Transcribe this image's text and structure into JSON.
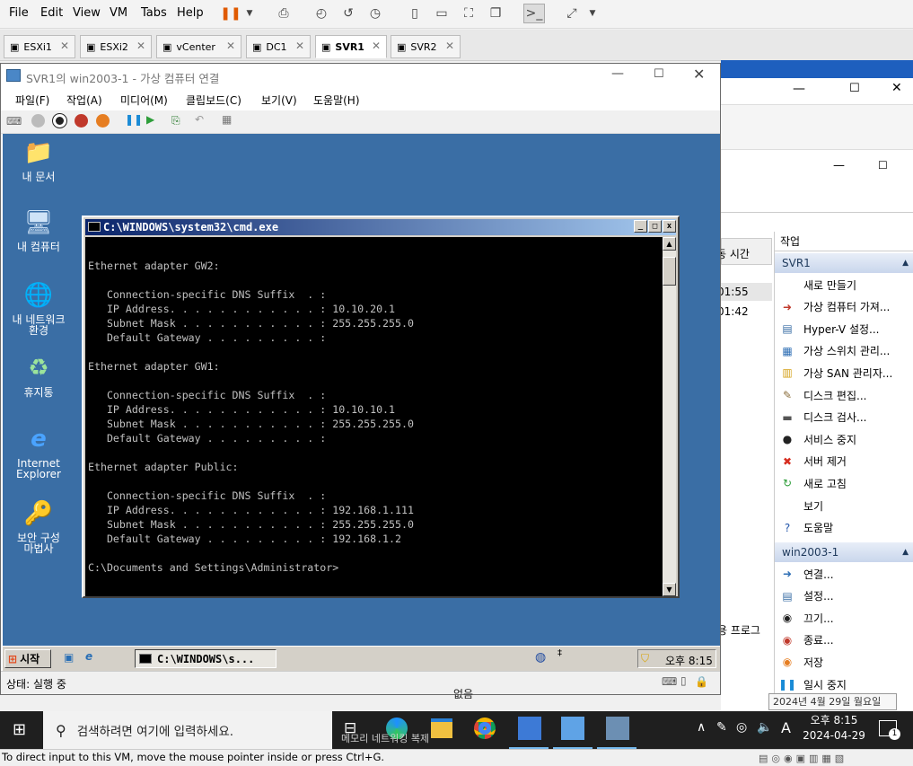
{
  "workstation": {
    "menu": [
      "File",
      "Edit",
      "View",
      "VM",
      "Tabs",
      "Help"
    ],
    "tabs": [
      {
        "label": "ESXi1",
        "active": false
      },
      {
        "label": "ESXi2",
        "active": false
      },
      {
        "label": "vCenter",
        "active": false
      },
      {
        "label": "DC1",
        "active": false
      },
      {
        "label": "SVR1",
        "active": true
      },
      {
        "label": "SVR2",
        "active": false
      }
    ],
    "status_text": "To direct input to this VM, move the mouse pointer inside or press Ctrl+G."
  },
  "vm_connection": {
    "title": "SVR1의 win2003-1 - 가상 컴퓨터 연결",
    "menu": [
      "파일(F)",
      "작업(A)",
      "미디어(M)",
      "클립보드(C)",
      "보기(V)",
      "도움말(H)"
    ],
    "status": "상태: 실행 중"
  },
  "desktop_icons": [
    {
      "label_1": "내 문서",
      "label_2": "",
      "icon": "folder-icon"
    },
    {
      "label_1": "내 컴퓨터",
      "label_2": "",
      "icon": "computer-icon"
    },
    {
      "label_1": "내 네트워크",
      "label_2": "환경",
      "icon": "network-icon"
    },
    {
      "label_1": "휴지통",
      "label_2": "",
      "icon": "recycle-bin-icon"
    },
    {
      "label_1": "Internet",
      "label_2": "Explorer",
      "icon": "ie-icon"
    },
    {
      "label_1": "보안 구성",
      "label_2": "마법사",
      "icon": "security-wizard-icon"
    }
  ],
  "cmd": {
    "title": "C:\\WINDOWS\\system32\\cmd.exe",
    "lines": [
      "",
      "Ethernet adapter GW2:",
      "",
      "   Connection-specific DNS Suffix  . :",
      "   IP Address. . . . . . . . . . . . : 10.10.20.1",
      "   Subnet Mask . . . . . . . . . . . : 255.255.255.0",
      "   Default Gateway . . . . . . . . . :",
      "",
      "Ethernet adapter GW1:",
      "",
      "   Connection-specific DNS Suffix  . :",
      "   IP Address. . . . . . . . . . . . : 10.10.10.1",
      "   Subnet Mask . . . . . . . . . . . : 255.255.255.0",
      "   Default Gateway . . . . . . . . . :",
      "",
      "Ethernet adapter Public:",
      "",
      "   Connection-specific DNS Suffix  . :",
      "   IP Address. . . . . . . . . . . . : 192.168.1.111",
      "   Subnet Mask . . . . . . . . . . . : 255.255.255.0",
      "   Default Gateway . . . . . . . . . : 192.168.1.2",
      "",
      "C:\\Documents and Settings\\Administrator>"
    ]
  },
  "xp_taskbar": {
    "start_label": "시작",
    "task_label": "C:\\WINDOWS\\s...",
    "clock": "오후 8:15"
  },
  "hyperv": {
    "actions_title": "작업",
    "col_fragment_1": "동 시간",
    "col_fragment_2": "01:55",
    "col_fragment_3": "01:42",
    "col_fragment_4": "용 프로그",
    "section_svr1": "SVR1",
    "svr1_items": [
      {
        "label": "새로 만들기",
        "icon": ""
      },
      {
        "label": "가상 컴퓨터 가져...",
        "icon": "import-icon"
      },
      {
        "label": "Hyper-V 설정...",
        "icon": "settings-page-icon"
      },
      {
        "label": "가상 스위치 관리...",
        "icon": "switch-icon"
      },
      {
        "label": "가상 SAN 관리자...",
        "icon": "san-icon"
      },
      {
        "label": "디스크 편집...",
        "icon": "disk-edit-icon"
      },
      {
        "label": "디스크 검사...",
        "icon": "disk-inspect-icon"
      },
      {
        "label": "서비스 중지",
        "icon": "stop-icon"
      },
      {
        "label": "서버 제거",
        "icon": "remove-icon"
      },
      {
        "label": "새로 고침",
        "icon": "refresh-icon"
      },
      {
        "label": "보기",
        "icon": ""
      },
      {
        "label": "도움말",
        "icon": "help-icon"
      }
    ],
    "section_vm": "win2003-1",
    "vm_items": [
      {
        "label": "연결...",
        "icon": "connect-icon"
      },
      {
        "label": "설정...",
        "icon": "settings-icon"
      },
      {
        "label": "끄기...",
        "icon": "turn-off-icon"
      },
      {
        "label": "종료...",
        "icon": "shutdown-icon"
      },
      {
        "label": "저장",
        "icon": "save-icon"
      },
      {
        "label": "일시 중지",
        "icon": "pause-icon"
      }
    ],
    "bottom_fragment_1": "없음",
    "date_tooltip": "2024년 4월 29일 월요일"
  },
  "win_taskbar": {
    "search_placeholder": "검색하려면 여기에 입력하세요.",
    "clock_time": "오후 8:15",
    "clock_date": "2024-04-29",
    "ime": "A",
    "notification_count": "1",
    "peek_text": "메모리 네트워킹 복제"
  }
}
